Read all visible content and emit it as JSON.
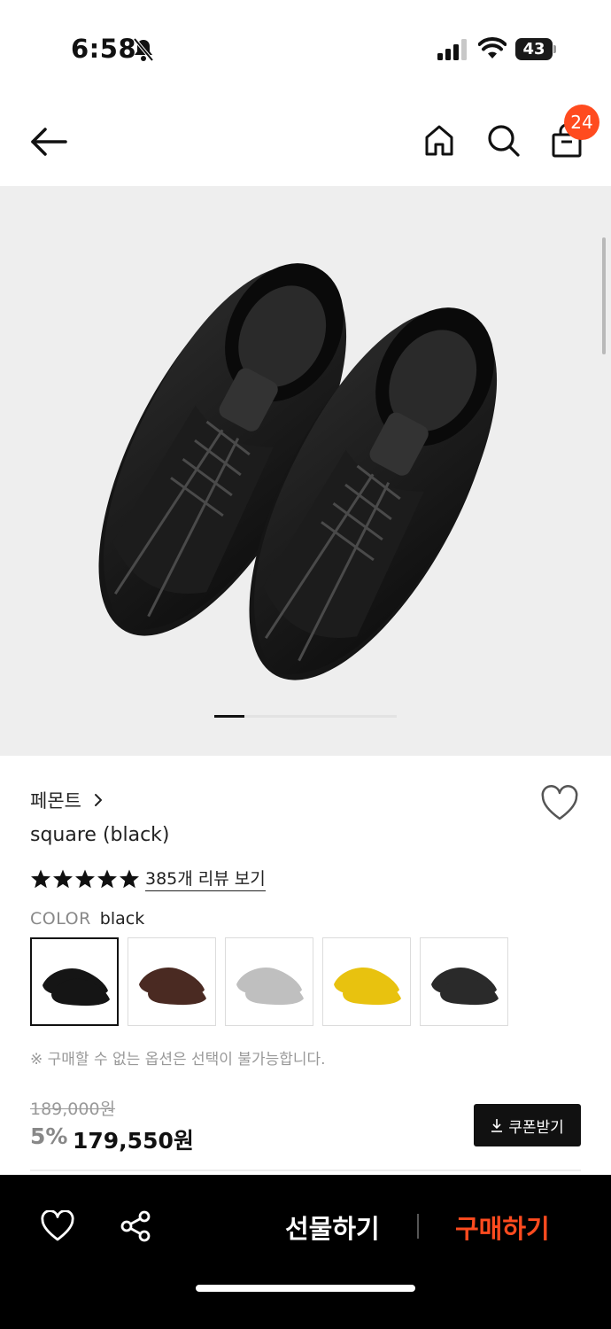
{
  "status_bar": {
    "time": "6:58",
    "battery": "43"
  },
  "header": {
    "cart_count": "24"
  },
  "product": {
    "brand": "페몬트",
    "name": "square (black)",
    "rating_stars": 5,
    "review_link": "385개 리뷰 보기",
    "color_label": "COLOR",
    "color_value": "black",
    "swatches": [
      {
        "color": "black",
        "hex": "#151515",
        "selected": true
      },
      {
        "color": "brown",
        "hex": "#4a2a22",
        "selected": false
      },
      {
        "color": "silver",
        "hex": "#bfbfbf",
        "selected": false
      },
      {
        "color": "yellow",
        "hex": "#e8c20f",
        "selected": false
      },
      {
        "color": "black",
        "hex": "#2a2a2a",
        "selected": false
      }
    ],
    "option_note": "※ 구매할 수 없는 옵션은 선택이 불가능합니다.",
    "original_price": "189,000원",
    "discount_rate": "5%",
    "sale_price": "179,550원",
    "coupon_button": "쿠폰받기"
  },
  "bottom_bar": {
    "gift_label": "선물하기",
    "buy_label": "구매하기",
    "buy_color": "#ff4b1f"
  },
  "icons": [
    "back-arrow-icon",
    "home-icon",
    "search-icon",
    "shopping-bag-icon",
    "heart-icon",
    "share-icon",
    "star-icon",
    "chevron-right-icon",
    "download-icon"
  ]
}
